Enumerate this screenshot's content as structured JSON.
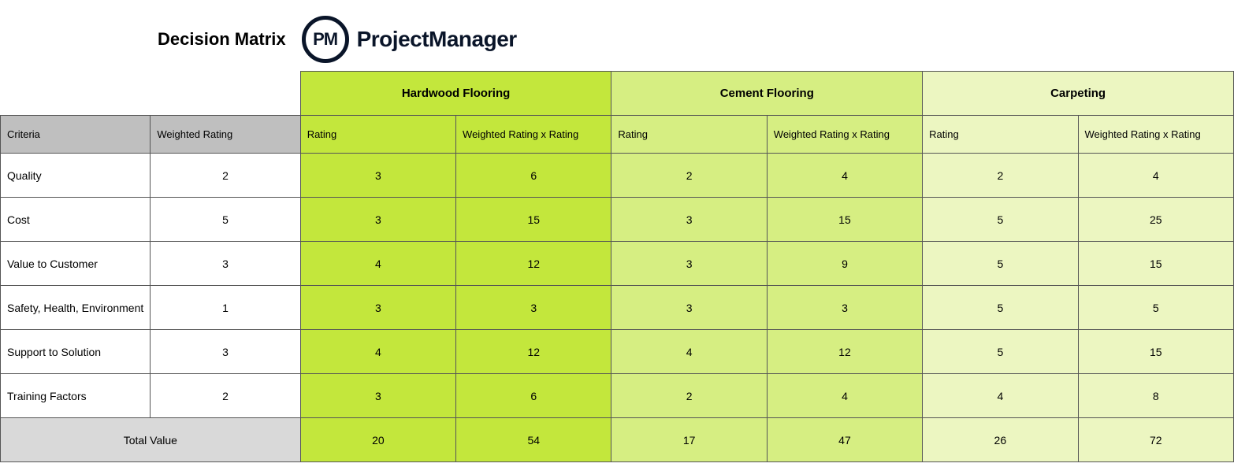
{
  "header": {
    "title": "Decision Matrix",
    "logo_initials": "PM",
    "logo_text": "ProjectManager"
  },
  "columns": {
    "criteria": "Criteria",
    "weighted_rating": "Weighted Rating",
    "rating": "Rating",
    "weighted_x_rating": "Weighted Rating x Rating"
  },
  "options": [
    {
      "name": "Hardwood Flooring"
    },
    {
      "name": "Cement Flooring"
    },
    {
      "name": "Carpeting"
    }
  ],
  "rows": [
    {
      "criteria": "Quality",
      "weight": 2,
      "vals": [
        [
          3,
          6
        ],
        [
          2,
          4
        ],
        [
          2,
          4
        ]
      ]
    },
    {
      "criteria": "Cost",
      "weight": 5,
      "vals": [
        [
          3,
          15
        ],
        [
          3,
          15
        ],
        [
          5,
          25
        ]
      ]
    },
    {
      "criteria": "Value to Customer",
      "weight": 3,
      "vals": [
        [
          4,
          12
        ],
        [
          3,
          9
        ],
        [
          5,
          15
        ]
      ]
    },
    {
      "criteria": "Safety, Health, Environment",
      "weight": 1,
      "vals": [
        [
          3,
          3
        ],
        [
          3,
          3
        ],
        [
          5,
          5
        ]
      ]
    },
    {
      "criteria": "Support to Solution",
      "weight": 3,
      "vals": [
        [
          4,
          12
        ],
        [
          4,
          12
        ],
        [
          5,
          15
        ]
      ]
    },
    {
      "criteria": "Training Factors",
      "weight": 2,
      "vals": [
        [
          3,
          6
        ],
        [
          2,
          4
        ],
        [
          4,
          8
        ]
      ]
    }
  ],
  "totals": {
    "label": "Total Value",
    "vals": [
      [
        20,
        54
      ],
      [
        17,
        47
      ],
      [
        26,
        72
      ]
    ]
  }
}
